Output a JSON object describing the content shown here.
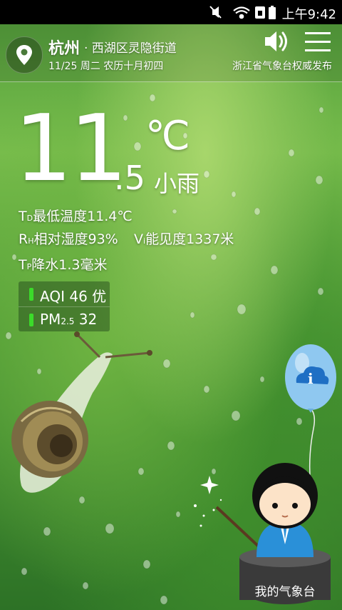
{
  "status_bar": {
    "time": "上午9:42"
  },
  "header": {
    "city": "杭州",
    "district": "· 西湖区灵隐街道",
    "date": "11/25 周二  农历十月初四",
    "publisher": "浙江省气象台权威发布"
  },
  "current": {
    "temp_int": "11",
    "temp_dec": ".5",
    "unit": "℃",
    "description": "小雨"
  },
  "stats": {
    "min_temp": {
      "prefix": "T",
      "sub": "D",
      "text": "最低温度11.4℃"
    },
    "humidity": {
      "prefix": "R",
      "sub": "H",
      "text": "相对湿度93%"
    },
    "visibility": {
      "prefix": "V",
      "sub": "i",
      "text": "能见度1337米"
    },
    "precip": {
      "prefix": "T",
      "sub": "P",
      "text": "降水1.3毫米"
    }
  },
  "air": {
    "aqi_label": "AQI",
    "aqi_value": "46",
    "aqi_level": "优",
    "pm_label": "PM",
    "pm_sub": "2.5",
    "pm_value": "32"
  },
  "mascot": {
    "label": "我的气象台"
  },
  "colors": {
    "aqi_good": "#3bdb2a",
    "balloon": "#8fc8f0",
    "mascot_shirt": "#2a90d8"
  },
  "icons": [
    "mute-icon",
    "wifi-icon",
    "sim-icon",
    "battery-icon",
    "location-pin-icon",
    "speaker-icon",
    "menu-icon",
    "info-cloud-icon"
  ]
}
